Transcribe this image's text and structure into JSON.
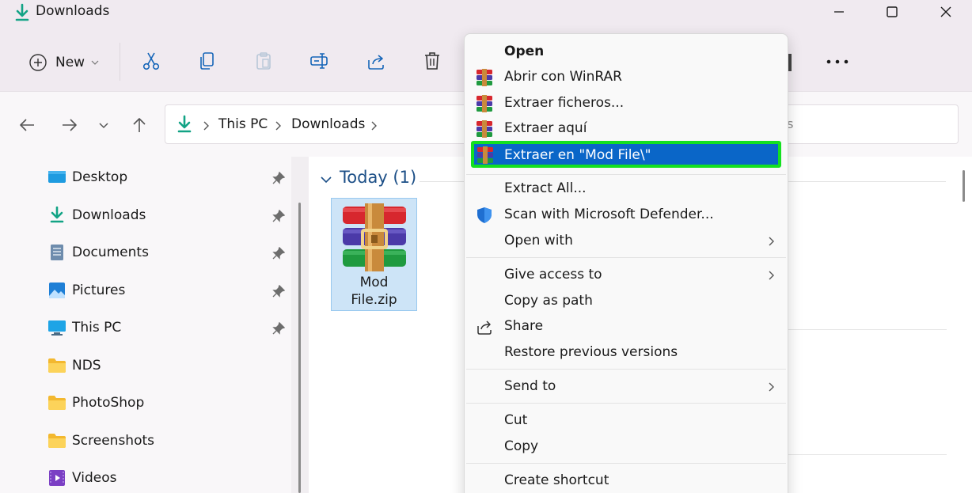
{
  "window": {
    "title": "Downloads"
  },
  "toolbar": {
    "new_label": "New"
  },
  "address": {
    "crumbs": [
      "This PC",
      "Downloads"
    ]
  },
  "search": {
    "placeholder_partial": "ds"
  },
  "sidebar": {
    "items": [
      {
        "label": "Desktop",
        "icon": "desktop-icon",
        "pinned": true
      },
      {
        "label": "Downloads",
        "icon": "download-icon",
        "pinned": true
      },
      {
        "label": "Documents",
        "icon": "document-icon",
        "pinned": true
      },
      {
        "label": "Pictures",
        "icon": "pictures-icon",
        "pinned": true
      },
      {
        "label": "This PC",
        "icon": "monitor-icon",
        "pinned": true
      },
      {
        "label": "NDS",
        "icon": "folder-icon",
        "pinned": false
      },
      {
        "label": "PhotoShop",
        "icon": "folder-icon",
        "pinned": false
      },
      {
        "label": "Screenshots",
        "icon": "folder-icon",
        "pinned": false
      },
      {
        "label": "Videos",
        "icon": "videos-icon",
        "pinned": false
      }
    ]
  },
  "files": {
    "group_title": "Today (1)",
    "items": [
      {
        "name_line1": "Mod",
        "name_line2": "File.zip",
        "icon": "winrar-archive-icon",
        "selected": true
      }
    ]
  },
  "context_menu": {
    "items": [
      {
        "label": "Open",
        "bold": true
      },
      {
        "label": "Abrir con WinRAR",
        "icon": "winrar-icon"
      },
      {
        "label": "Extraer ficheros...",
        "icon": "winrar-icon"
      },
      {
        "label": "Extraer aquí",
        "icon": "winrar-icon"
      },
      {
        "label": "Extraer en \"Mod File\\\"",
        "icon": "winrar-icon",
        "highlighted": true
      },
      {
        "label": "Extract All..."
      },
      {
        "label": "Scan with Microsoft Defender...",
        "icon": "defender-shield-icon"
      },
      {
        "label": "Open with",
        "submenu": true
      },
      {
        "label": "Give access to",
        "submenu": true
      },
      {
        "label": "Copy as path"
      },
      {
        "label": "Share",
        "icon": "share-icon"
      },
      {
        "label": "Restore previous versions"
      },
      {
        "label": "Send to",
        "submenu": true
      },
      {
        "label": "Cut"
      },
      {
        "label": "Copy"
      },
      {
        "label": "Create shortcut"
      }
    ]
  },
  "colors": {
    "accent": "#0a66c8",
    "highlight_border": "#14e020",
    "download_green": "#12a385",
    "group_title": "#1c4f87",
    "selection_fill": "#cde4f7"
  }
}
